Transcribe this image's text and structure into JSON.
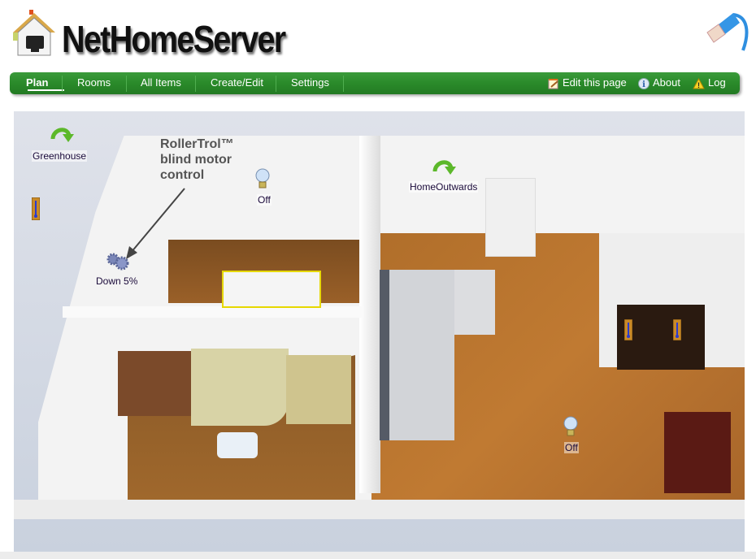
{
  "app": {
    "title": "NetHomeServer",
    "logo_icon": "house-ethernet-icon",
    "decor_icon": "ethernet-cable-icon"
  },
  "nav": {
    "items": [
      {
        "label": "Plan",
        "active": true
      },
      {
        "label": "Rooms",
        "active": false
      },
      {
        "label": "All Items",
        "active": false
      },
      {
        "label": "Create/Edit",
        "active": false
      },
      {
        "label": "Settings",
        "active": false
      }
    ],
    "right_items": [
      {
        "label": "Edit this page",
        "icon": "edit-note-icon"
      },
      {
        "label": "About",
        "icon": "info-icon"
      },
      {
        "label": "Log",
        "icon": "warning-icon"
      }
    ],
    "colors": {
      "bar": "#2a8a2a",
      "text": "#ffffff"
    }
  },
  "plan": {
    "annotation": [
      "RollerTrol™",
      "blind motor",
      "control"
    ],
    "items": [
      {
        "type": "link",
        "icon": "green-arrow-icon",
        "label": "Greenhouse"
      },
      {
        "type": "thermometer",
        "icon": "thermometer-icon",
        "label": ""
      },
      {
        "type": "lamp",
        "icon": "light-bulb-icon",
        "label": "Off"
      },
      {
        "type": "blind",
        "icon": "gears-icon",
        "label": "Down 5%"
      },
      {
        "type": "link",
        "icon": "green-arrow-icon",
        "label": "HomeOutwards"
      },
      {
        "type": "thermometer",
        "icon": "thermometer-icon",
        "label": ""
      },
      {
        "type": "thermometer",
        "icon": "thermometer-icon",
        "label": ""
      },
      {
        "type": "lamp",
        "icon": "light-bulb-icon",
        "label": "Off"
      }
    ]
  }
}
